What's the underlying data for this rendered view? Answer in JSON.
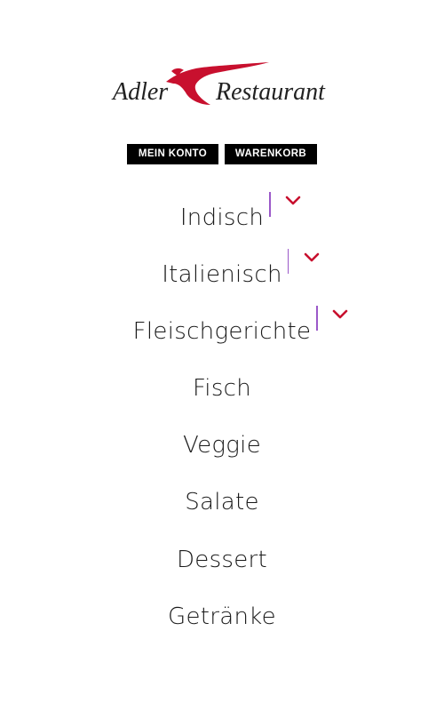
{
  "logo": {
    "text_left": "Adler",
    "text_right": "Restaurant",
    "accent_color": "#c8102e"
  },
  "account": {
    "konto_label": "MEIN KONTO",
    "korb_label": "WARENKORB"
  },
  "menu": {
    "items": [
      {
        "label": "Indisch",
        "has_submenu": true
      },
      {
        "label": "Italienisch",
        "has_submenu": true
      },
      {
        "label": "Fleischgerichte",
        "has_submenu": true
      },
      {
        "label": "Fisch",
        "has_submenu": false
      },
      {
        "label": "Veggie",
        "has_submenu": false
      },
      {
        "label": "Salate",
        "has_submenu": false
      },
      {
        "label": "Dessert",
        "has_submenu": false
      },
      {
        "label": "Getränke",
        "has_submenu": false
      }
    ]
  },
  "colors": {
    "chevron": "#c8102e",
    "divider": "#9b59c9",
    "button_bg": "#000000",
    "text": "#1a1a1a"
  }
}
